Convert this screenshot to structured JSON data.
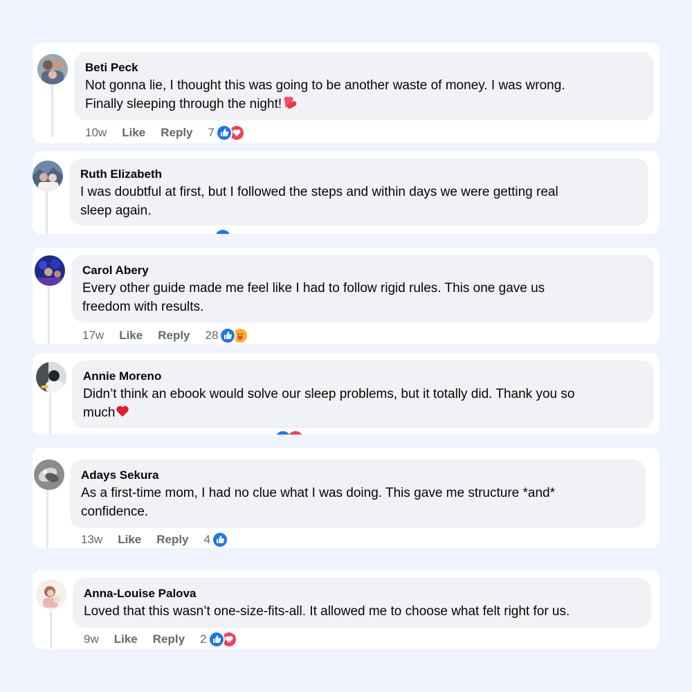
{
  "comments": [
    {
      "name": "Beti Peck",
      "line1": "Not gonna lie, I thought this was going to be another waste of money. I was wrong.",
      "line2": "Finally sleeping through the night!",
      "time": "10w",
      "like": "Like",
      "reply": "Reply",
      "count": "7",
      "reactions": [
        "like-icon",
        "love-icon"
      ]
    },
    {
      "name": "Ruth Elizabeth",
      "line1": "I was doubtful at first, but I followed the steps and within days we were getting real",
      "line2": "sleep again."
    },
    {
      "name": "Carol Abery",
      "line1": "Every other guide made me feel like I had to follow rigid rules. This one gave us",
      "line2": "freedom with results.",
      "time": "17w",
      "like": "Like",
      "reply": "Reply",
      "count": "28",
      "reactions": [
        "like-icon",
        "care-icon"
      ]
    },
    {
      "name": "Annie Moreno",
      "line1": "Didn’t think an ebook would solve our sleep problems, but it totally did. Thank you so",
      "line2": "much"
    },
    {
      "name": "Adays Sekura",
      "line1": "As a first-time mom, I had no clue what I was doing. This gave me structure *and*",
      "line2": "confidence.",
      "time": "13w",
      "like": "Like",
      "reply": "Reply",
      "count": "4",
      "reactions": [
        "like-icon"
      ]
    },
    {
      "name": "Anna-Louise Palova",
      "line1": "Loved that this wasn’t one-size-fits-all. It allowed me to choose what felt right for us.",
      "time": "9w",
      "like": "Like",
      "reply": "Reply",
      "count": "2",
      "reactions": [
        "like-icon",
        "love-icon"
      ]
    }
  ],
  "colors": {
    "background": "#eef3fd",
    "bubble": "#f0f2f5",
    "like": "#1877f2",
    "love": "#f33e58",
    "meta": "#65676b"
  }
}
